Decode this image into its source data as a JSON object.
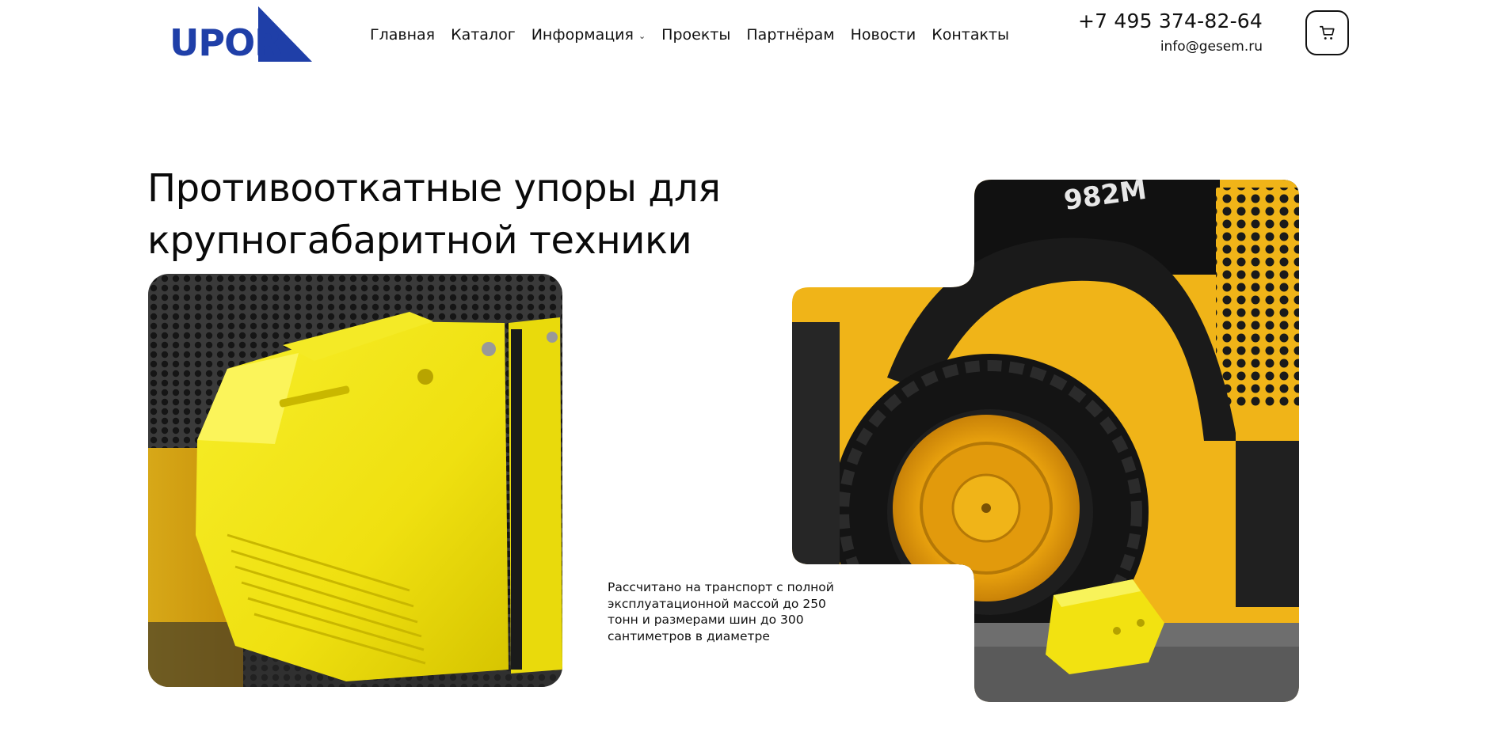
{
  "header": {
    "logo_text": "UPOR",
    "nav": [
      {
        "label": "Главная"
      },
      {
        "label": "Каталог"
      },
      {
        "label": "Информация",
        "has_dropdown": true
      },
      {
        "label": "Проекты"
      },
      {
        "label": "Партнёрам"
      },
      {
        "label": "Новости"
      },
      {
        "label": "Контакты"
      }
    ],
    "phone": "+7 495 374-82-64",
    "email": "info@gesem.ru",
    "cart_icon": "cart-icon",
    "dropdown_icon": "chevron-down-icon"
  },
  "hero": {
    "title_line1": "Противооткатные упоры для",
    "title_line2": "крупногабаритной техники",
    "caption": "Рассчитано на транспорт с полной эксплуатационной массой до 250 тонн и размерами шин до 300 сантиметров в диаметре",
    "left_image_subject": "yellow wheel chock close-up",
    "right_image_subject": "CAT 982M loader wheel with yellow chock",
    "right_image_text": "982M"
  },
  "colors": {
    "logo_blue": "#1f3fa8",
    "text": "#111111",
    "background": "#ffffff",
    "chock_yellow": "#f3e515",
    "cat_yellow": "#f2b51b"
  }
}
